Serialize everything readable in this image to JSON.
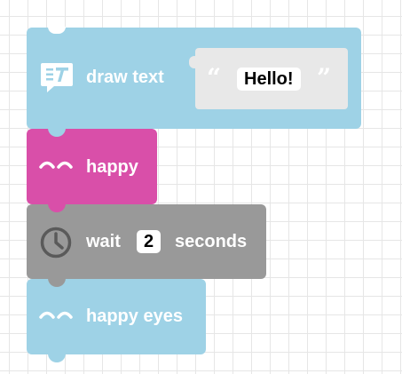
{
  "blocks": {
    "draw_text": {
      "label": "draw text",
      "icon": "draw-text-icon",
      "value": "Hello!",
      "quote_open": "“",
      "quote_close": "”",
      "color": "#9ed2e6"
    },
    "happy": {
      "label": "happy",
      "icon": "happy-eyes-icon",
      "color": "#d94fa9"
    },
    "wait": {
      "label": "wait",
      "icon": "clock-icon",
      "value": "2",
      "unit": "seconds",
      "color": "#999999"
    },
    "happy_eyes": {
      "label": "happy eyes",
      "icon": "happy-eyes-icon",
      "color": "#9ed2e6"
    }
  }
}
